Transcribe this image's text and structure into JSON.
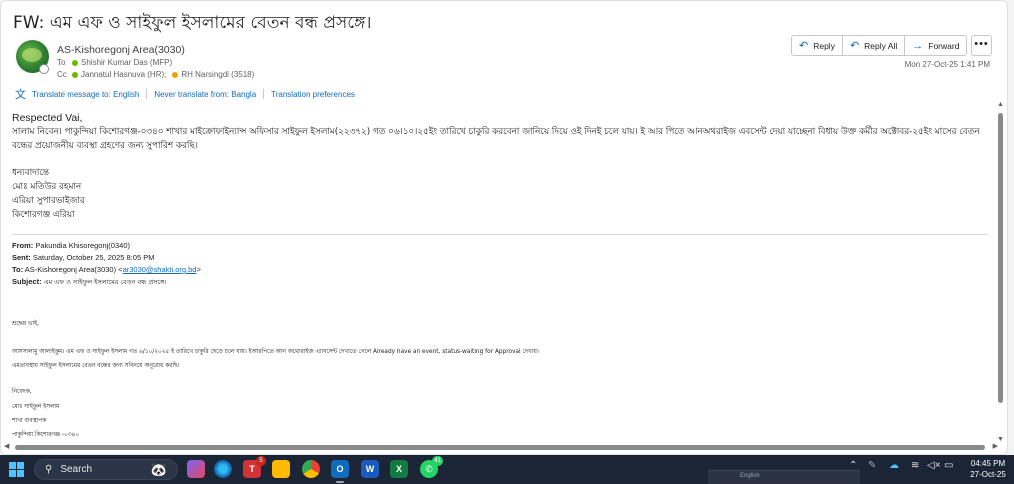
{
  "email": {
    "subject": "FW: এম এফ ও সাইফুল ইসলামের বেতন বন্ধ প্রসঙ্গে।",
    "sender": "AS-Kishoregonj Area(3030)",
    "to_label": "To",
    "to": "Shishir Kumar Das (MFP)",
    "cc_label": "Cc",
    "cc": [
      "Jannatul Hasnuva (HR);",
      "RH Narsingdi (3518)"
    ],
    "datetime": "Mon 27-Oct-25 1:41 PM"
  },
  "actions": {
    "reply": "Reply",
    "reply_all": "Reply All",
    "forward": "Forward",
    "more": "•••"
  },
  "translate": {
    "link1": "Translate message to: English",
    "link2": "Never translate from: Bangla",
    "link3": "Translation preferences"
  },
  "body": {
    "greeting": "Respected Vai,",
    "paragraph": "সালাম নিবেন। পাকুন্দিয়া কিশোরগঞ্জ-০৩৪০ শাখার মাইক্রোফাইন্যান্স অফিসার সাইফুল ইসলাম(২২৩৭২) গত ০৬।১০।২৫ইং তারিখে চাকুরি করবেনা জানিয়ে দিয়ে ওই দিনই চলে যায়। ই আর পিতে আনঅথরাইজ এবসেন্ট দেয়া যাচ্ছেনা বিধায় উক্ত কর্মীর অক্টোবর-২৫ইং মাসের বেতন বন্ধের প্রয়োজনীয় ব্যবস্থা গ্রহণের জন্য সুপারিশ করছি।",
    "sig_closing": "ধন্যবাদান্তে",
    "sig_name": "মোঃ মতিউর রহমান",
    "sig_title": "এরিয়া সুপারভাইজার",
    "sig_area": "কিশোরগঞ্জ এরিয়া"
  },
  "forwarded": {
    "from_label": "From:",
    "from": "Pakundia Khisoregonj(0340)",
    "sent_label": "Sent:",
    "sent": "Saturday, October 25, 2025 8:05 PM",
    "to_label": "To:",
    "to": "AS-Kishoregonj Area(3030) <",
    "to_email": "ar3030@shakti.org.bd",
    "to_end": ">",
    "subject_label": "Subject:",
    "subject": "এম এফ ও সাইফুল ইসলামের বেতন বন্ধ প্রসঙ্গে।"
  },
  "original": {
    "salutation": "শ্রদ্ধেয় ভাই,",
    "line1": "আসসালামু আলাইকুম। এম এফ ও সাইফুল ইসলাম গত ৬/১০/২০২৫ ই তারিখে চাকুরি ছেড়ে চলে যায়। ইআরপিতে আন অথোরাইজ এ্যাবসেন্ট দেখাতে গেলে Already have an event, status-waiting for Approval দেখায়।",
    "line2": "এমতাবস্থায় সাইফুল ইসলামের বেতন বন্ধের জন্য সবিনয়ে অনুরোধ করছি।",
    "sig1": "নিবেদক,",
    "sig2": "মোঃ সাইফুল ইসলাম",
    "sig3": "শাখা ব্যবস্থাপক",
    "sig4": "পাকুন্দিয়া কিশোরগঞ্জ -০৩৪০"
  },
  "taskbar": {
    "search_placeholder": "Search",
    "badge_mail": "5",
    "badge_whatsapp": "41",
    "lang_text": "English",
    "time": "04:45 PM",
    "date": "27-Oct-25"
  },
  "colors": {
    "accent": "#0f6cbd",
    "taskbar": "#1c2536",
    "presence_green": "#6bb700"
  }
}
